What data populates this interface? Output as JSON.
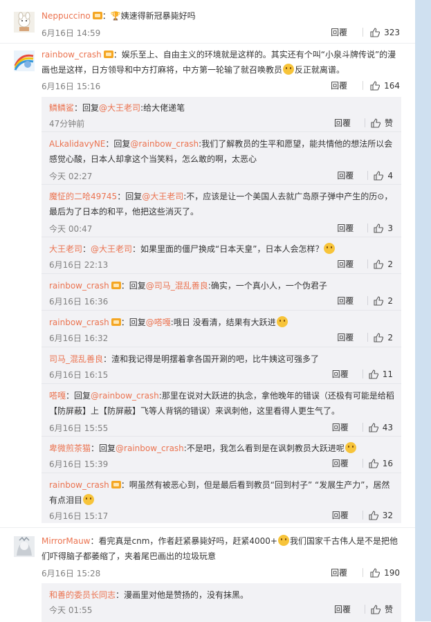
{
  "reply_label": "回覆",
  "comments": [
    {
      "name": "Neppuccino",
      "text": "：🏆姨速得新冠暴毙好吗",
      "time": "6月16日 14:59",
      "likes": "323"
    },
    {
      "name": "rainbow_crash",
      "text": "：娱乐至上、自由主义的环境就是这样的。其实还有个叫“小泉斗牌传说”的漫画也是这样，日方领导和中方打麻将，中方第一轮输了就召唤教员",
      "text2": "反正就离谱。",
      "time": "6月16日 15:16",
      "likes": "164"
    },
    {
      "name": "MirrorMauw",
      "text": "：看完真是cnm，作者赶紧暴毙好吗，赶紧4000+",
      "text2": "我们国家千古伟人是不是把他们吓得脑子都萎缩了，夹着尾巴画出的垃圾玩意",
      "time": "6月16日 15:28",
      "likes": "190"
    }
  ],
  "subs_a": [
    {
      "name": "鳞鳞鲨",
      "pre": "：回复",
      "at": "@大王老司",
      "text": ":给大佬递笔",
      "time": "47分钟前",
      "likes": "赞"
    },
    {
      "name": "ALkalidavyNE",
      "pre": "：回复",
      "at": "@rainbow_crash",
      "text": ":我们了解教员的生平和愿望，能共情他的想法所以会感觉心酸，日本人却拿这个当笑料，怎么敢的啊，太恶心",
      "time": "今天 02:27",
      "likes": "4"
    },
    {
      "name": "魔怔的二哈49745",
      "pre": "：回复",
      "at": "@大王老司",
      "text": ":不，应该是让一个美国人去就广岛原子弹中产生的历⊙，最后为了日本的和平，他把这些消灭了。",
      "time": "今天 00:47",
      "likes": "3"
    },
    {
      "name": "大王老司",
      "pre": "：",
      "at": "@大王老司",
      "text": "：如果里面的僵尸换成“日本天皇”，日本人会怎样？",
      "time": "6月16日 22:13",
      "likes": "2"
    },
    {
      "name": "rainbow_crash",
      "pre": "：回复",
      "at": "@司马_混乱善良",
      "text": ":确实，一个真小人，一个伪君子",
      "time": "6月16日 16:36",
      "likes": "2"
    },
    {
      "name": "rainbow_crash",
      "pre": "：回复",
      "at": "@嗒嘎",
      "text": ":哦日 没看清，结果有大跃进",
      "time": "6月16日 16:32",
      "likes": "2"
    },
    {
      "name": "司马_混乱善良",
      "pre": "",
      "at": "",
      "text": "：渣和我记得是明摆着拿各国开涮的吧，比牛姨这可强多了",
      "time": "6月16日 16:15",
      "likes": "11"
    },
    {
      "name": "嗒嘎",
      "pre": "：回复",
      "at": "@rainbow_crash",
      "text": ":那里在说对大跃进的执念，拿他晚年的错误（还极有可能是给稻【防屏蔽】上【防屏蔽】飞等人背锅的错误）来讽刺他，这里看得人更生气了。",
      "time": "6月16日 15:55",
      "likes": "43"
    },
    {
      "name": "卑微煎茶猫",
      "pre": "：回复",
      "at": "@rainbow_crash",
      "text": ":不是吧，我怎么看到是在讽刺教员大跃进呢",
      "time": "6月16日 15:39",
      "likes": "16"
    },
    {
      "name": "rainbow_crash",
      "pre": "",
      "at": "",
      "text": "：啊虽然有被恶心到，但是最后看到教员“回到村子” “发展生产力”，居然有点泪目",
      "time": "6月16日 15:17",
      "likes": "32"
    }
  ],
  "subs_b": [
    {
      "name": "和善的委员长同志",
      "pre": "",
      "at": "",
      "text": "：漫画里对他是赞扬的，没有抹黑。",
      "time": "今天 01:55",
      "likes": "赞"
    }
  ]
}
